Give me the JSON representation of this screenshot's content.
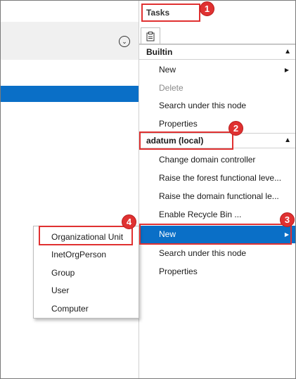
{
  "tasks_title": "Tasks",
  "sections": [
    {
      "header": "Builtin",
      "items": [
        {
          "label": "New",
          "has_submenu": true,
          "enabled": true
        },
        {
          "label": "Delete",
          "enabled": false
        },
        {
          "label": "Search under this node",
          "enabled": true
        },
        {
          "label": "Properties",
          "enabled": true
        }
      ]
    },
    {
      "header": "adatum (local)",
      "items": [
        {
          "label": "Change domain controller",
          "enabled": true
        },
        {
          "label": "Raise the forest functional leve...",
          "enabled": true
        },
        {
          "label": "Raise the domain functional le...",
          "enabled": true
        },
        {
          "label": "Enable Recycle Bin ...",
          "enabled": true
        },
        {
          "label": "New",
          "has_submenu": true,
          "enabled": true,
          "selected": true
        },
        {
          "label": "Search under this node",
          "enabled": true
        },
        {
          "label": "Properties",
          "enabled": true
        }
      ]
    }
  ],
  "submenu": {
    "items": [
      "Organizational Unit",
      "InetOrgPerson",
      "Group",
      "User",
      "Computer"
    ]
  },
  "callouts": [
    "1",
    "2",
    "3",
    "4"
  ],
  "colors": {
    "selection": "#0a6fc7",
    "callout": "#e03131",
    "header_bg": "#f0f0f0"
  },
  "icons": {
    "tab": "clipboard-icon",
    "collapse": "chevron-up-icon",
    "submenu_arrow": "triangle-right-icon",
    "header_chevron": "circle-chevron-down-icon"
  }
}
